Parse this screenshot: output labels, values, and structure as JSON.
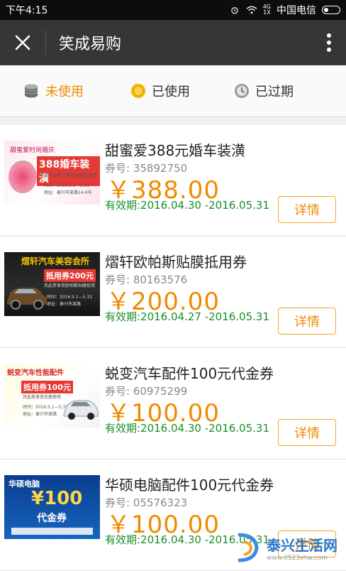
{
  "status": {
    "time": "下午4:15",
    "net": "4G\n1X",
    "carrier": "中国电信"
  },
  "titlebar": {
    "title": "笑成易购",
    "close_icon": "close-icon",
    "more_icon": "more-vertical-icon"
  },
  "tabs": [
    {
      "label": "未使用",
      "icon": "coin-stack-icon",
      "active": true
    },
    {
      "label": "已使用",
      "icon": "coin-icon",
      "active": false
    },
    {
      "label": "已过期",
      "icon": "clock-icon",
      "active": false
    }
  ],
  "coupons": [
    {
      "name": "甜蜜爱388元婚车装潢",
      "number_label": "券号:",
      "number": "35892750",
      "price": "￥388.00",
      "validity": "有效期:2016.04.30 -2016.05.31",
      "button": "详情",
      "thumb": {
        "title": "甜蜜爱时尚婚庆",
        "headline": "388婚车装潢",
        "line": "凭此券享受订购5888婚庆套餐",
        "date": "时间：2016.5.1—5.31",
        "addr": "地址：泰兴市某路14-9号"
      }
    },
    {
      "name": "熠轩欧帕斯贴膜抵用券",
      "number_label": "券号:",
      "number": "80163576",
      "price": "￥200.00",
      "validity": "有效期:2016.04.27 -2016.05.31",
      "button": "详情",
      "thumb": {
        "title": "熠轩汽车美容会所",
        "headline": "抵用券200元",
        "line": "凭此券享受欧帕斯贴膜抵用",
        "date": "时间：2016.5.1—5.31",
        "addr": "地址：泰兴市某路"
      }
    },
    {
      "name": "蜕变汽车配件100元代金券",
      "number_label": "券号:",
      "number": "60975299",
      "price": "￥100.00",
      "validity": "有效期:2016.04.30 -2016.05.31",
      "button": "详情",
      "thumb": {
        "title": "蜕变汽车性能配件",
        "headline": "抵用券100元",
        "line": "凭此券享受优惠使用",
        "date": "时间：2016.5.1—5.31",
        "addr": "地址：泰兴市某路"
      }
    },
    {
      "name": "华硕电脑配件100元代金券",
      "number_label": "券号:",
      "number": "05576323",
      "price": "￥100.00",
      "validity": "有效期:2016.04.30 -2016.05.31",
      "button": "详情",
      "thumb": {
        "title": "华硕电脑",
        "headline": "¥100",
        "line": "代金券",
        "date": "",
        "addr": ""
      }
    }
  ],
  "watermark": {
    "name": "泰兴生活网",
    "url": "www.0523shw.com"
  },
  "colors": {
    "accent": "#f08a00",
    "valid": "#1a8f2a",
    "titlebar": "#363636"
  }
}
